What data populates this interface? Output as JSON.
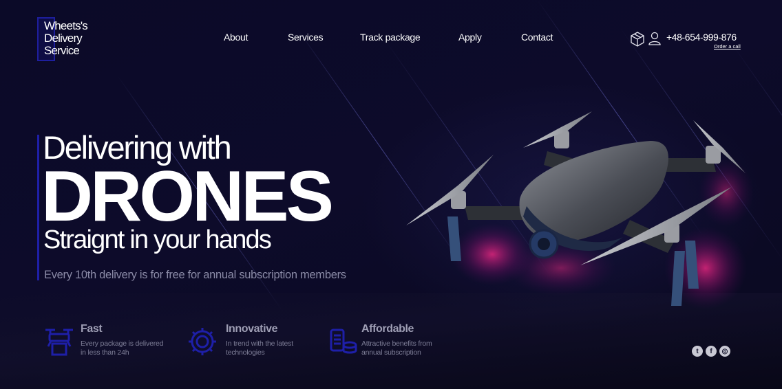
{
  "brand": {
    "logo_lines": [
      "Wheets's",
      "Delivery",
      "Service"
    ]
  },
  "nav": {
    "items": [
      {
        "id": "about",
        "label": "About"
      },
      {
        "id": "services",
        "label": "Services"
      },
      {
        "id": "track",
        "label": "Track package"
      },
      {
        "id": "apply",
        "label": "Apply"
      },
      {
        "id": "contact",
        "label": "Contact"
      }
    ]
  },
  "header": {
    "icons": [
      "package-icon",
      "user-icon"
    ],
    "phone": "+48-654-999-876",
    "order_link": "Order a call"
  },
  "hero": {
    "line1": "Delivering with",
    "line2": "DRONES",
    "line3": "Straignt in your hands",
    "note": "Every 10th delivery is for free for annual subscription members"
  },
  "features": [
    {
      "icon": "drone-delivery-icon",
      "title": "Fast",
      "desc": [
        "Every package is delivered",
        "in less than 24h"
      ]
    },
    {
      "icon": "gear-icon",
      "title": "Innovative",
      "desc": [
        "In trend with the latest",
        "technologies"
      ]
    },
    {
      "icon": "coins-icon",
      "title": "Affordable",
      "desc": [
        "Attractive benefits from",
        "annual subscription"
      ]
    }
  ],
  "social": [
    {
      "icon": "twitter-icon",
      "glyph": "t"
    },
    {
      "icon": "facebook-icon",
      "glyph": "f"
    },
    {
      "icon": "instagram-icon",
      "glyph": "◎"
    }
  ],
  "colors": {
    "background": "#0c0a26",
    "accent": "#1e1fa8",
    "glow": "#ff2a8a"
  }
}
